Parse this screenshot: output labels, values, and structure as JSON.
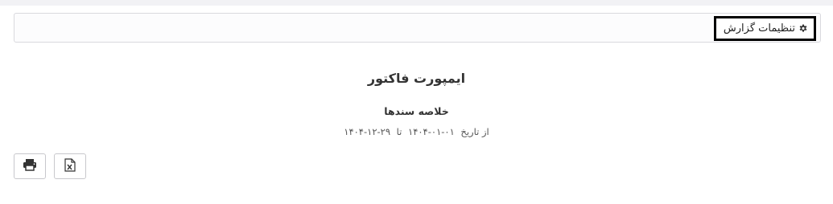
{
  "settings": {
    "button_label": "تنظیمات گزارش",
    "icon": "gear-icon"
  },
  "report": {
    "title": "ایمپورت فاکتور",
    "subtitle": "خلاصه سندها",
    "date_range": {
      "from_label": "از تاریخ",
      "from_date": "۱۴۰۴-۰۱-۰۱",
      "to_label": "تا",
      "to_date": "۱۴۰۴-۱۲-۲۹"
    }
  },
  "toolbar": {
    "print_icon": "printer-icon",
    "excel_icon": "excel-file-icon"
  }
}
